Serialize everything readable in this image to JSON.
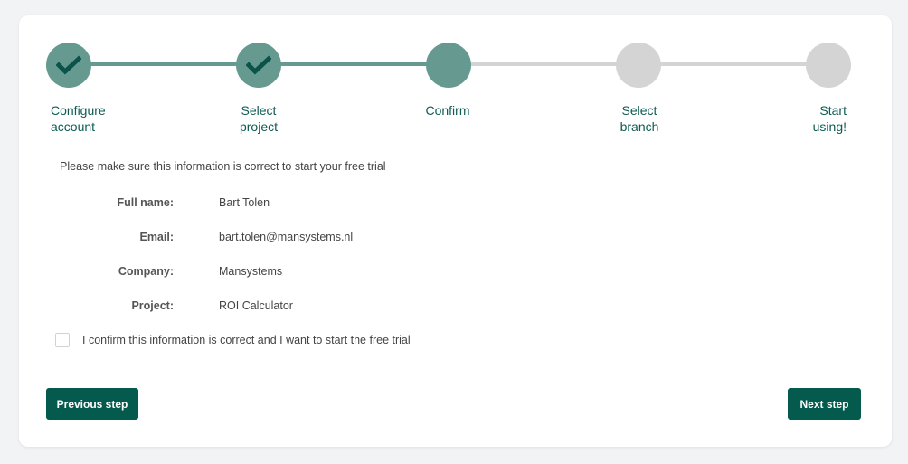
{
  "colors": {
    "completed": "#669a91",
    "pending": "#d4d4d4",
    "check": "#0b5249",
    "label": "#0d5b53",
    "button": "#055a4e"
  },
  "steps": [
    {
      "label_line1": "Configure",
      "label_line2": "account",
      "status": "completed",
      "icon": "checkmark-icon"
    },
    {
      "label_line1": "Select",
      "label_line2": "project",
      "status": "completed",
      "icon": "checkmark-icon"
    },
    {
      "label_line1": "Confirm",
      "label_line2": "",
      "status": "current",
      "icon": ""
    },
    {
      "label_line1": "Select",
      "label_line2": "branch",
      "status": "pending",
      "icon": ""
    },
    {
      "label_line1": "Start",
      "label_line2": "using!",
      "status": "pending",
      "icon": ""
    }
  ],
  "intro_text": "Please make sure this information is correct to start your free trial",
  "summary": [
    {
      "label": "Full name:",
      "value": "Bart Tolen"
    },
    {
      "label": "Email:",
      "value": "bart.tolen@mansystems.nl"
    },
    {
      "label": "Company:",
      "value": "Mansystems"
    },
    {
      "label": "Project:",
      "value": "ROI Calculator"
    }
  ],
  "confirm": {
    "label": "I confirm this information is correct and I want to start the free trial",
    "checked": false
  },
  "buttons": {
    "previous": "Previous step",
    "next": "Next step"
  }
}
